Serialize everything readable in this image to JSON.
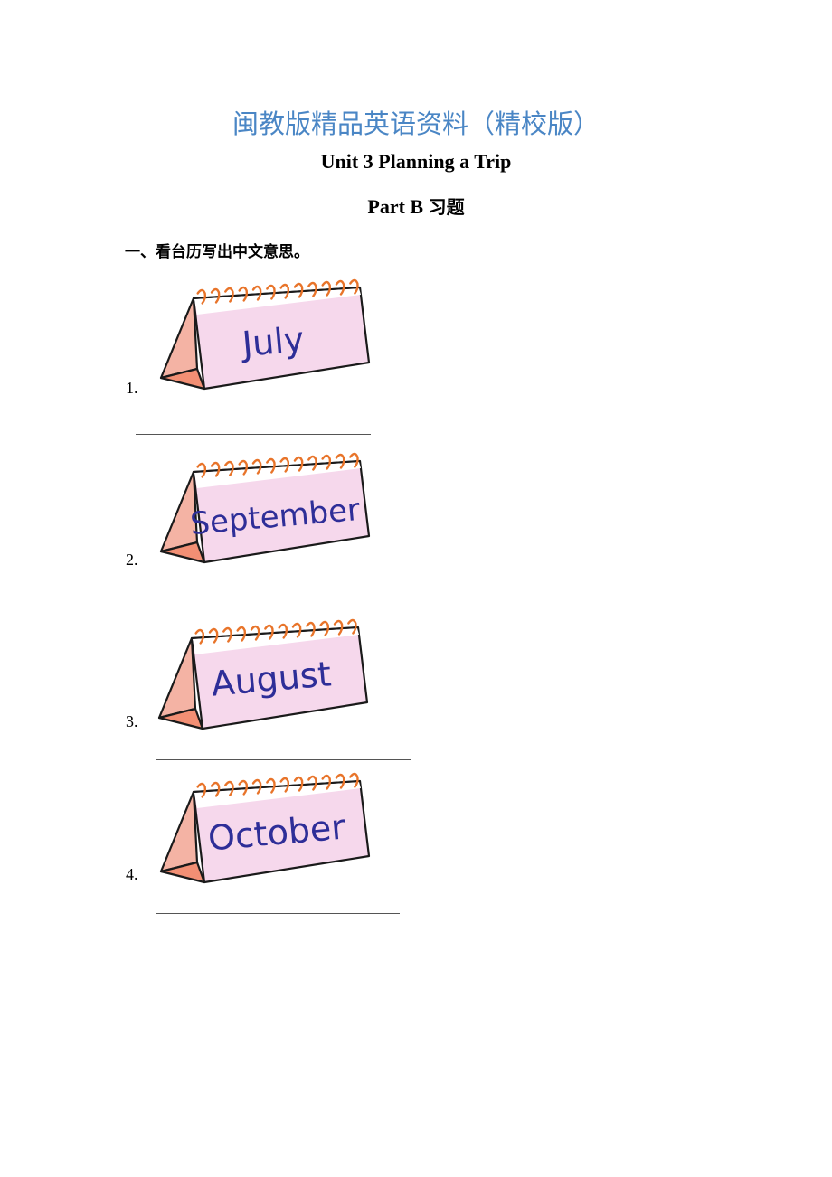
{
  "header": {
    "banner": "闽教版精品英语资料（精校版）",
    "unit_title": "Unit 3 Planning a Trip",
    "part_title_en": "Part B",
    "part_title_cn": "习题"
  },
  "section": {
    "instruction": "一、看台历写出中文意思。"
  },
  "items": [
    {
      "number": "1.",
      "month": "July",
      "answer": ""
    },
    {
      "number": "2.",
      "month": "September",
      "answer": ""
    },
    {
      "number": "3.",
      "month": "August",
      "answer": ""
    },
    {
      "number": "4.",
      "month": "October",
      "answer": ""
    }
  ],
  "colors": {
    "banner": "#4a86c5",
    "calendar_page": "#f6d8ec",
    "calendar_side": "#f4b3a4",
    "calendar_base": "#f28f74",
    "calendar_rings": "#e8742a",
    "month_text": "#2e2e98"
  }
}
